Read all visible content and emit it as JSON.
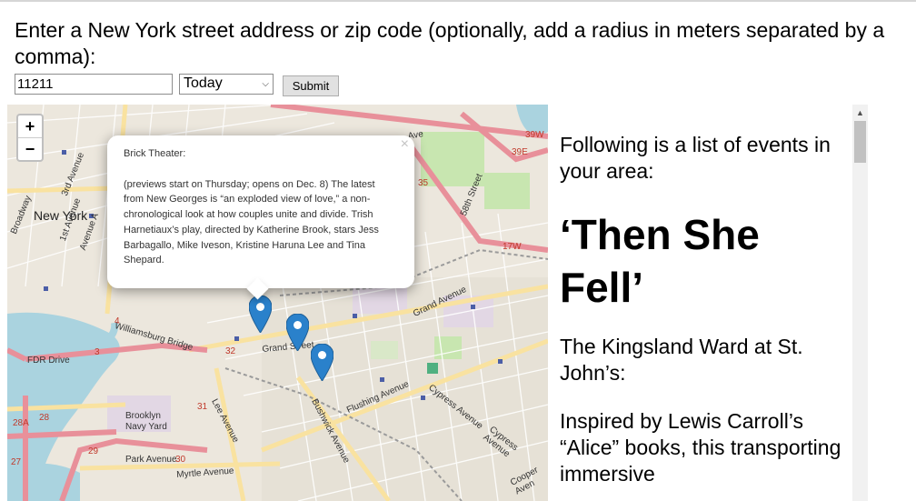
{
  "form": {
    "prompt": "Enter a New York street address or zip code (optionally, add a radius in meters separated by a comma):",
    "address_value": "11211",
    "day_selected": "Today",
    "submit_label": "Submit"
  },
  "map": {
    "zoom_in": "+",
    "zoom_out": "−",
    "labels": {
      "new_york": "New York",
      "broadway": "Broadway",
      "williamsburg_bridge": "Williamsburg Bridge",
      "fdr_drive": "FDR Drive",
      "grand_street": "Grand Street",
      "grand_avenue": "Grand Avenue",
      "flushing_avenue": "Flushing Avenue",
      "cypress_avenue": "Cypress Avenue",
      "cypress_avenue_2": "Cypress Avenue",
      "bushwick_avenue": "Bushwick Avenue",
      "lee_avenue": "Lee Avenue",
      "navy_yard": "Brooklyn Navy Yard",
      "park_avenue": "Park Avenue",
      "myrtle_avenue": "Myrtle Avenue",
      "cooper_avenue": "Cooper Aven",
      "st58": "58th Street",
      "ave_1st": "1st Avenue",
      "ave_a": "Avenue A",
      "ave_3rd": "3rd Avenue",
      "route_39w": "39W",
      "route_39e": "39E",
      "route_17w": "17W",
      "route_35": "35",
      "route_4": "4",
      "route_3": "3",
      "route_32": "32",
      "route_31": "31",
      "route_28": "28",
      "route_28a": "28A",
      "route_29": "29",
      "route_30": "30",
      "route_27": "27",
      "ave": "Ave"
    },
    "popup": {
      "title": "Brick Theater:",
      "body": "(previews start on Thursday; opens on Dec. 8) The latest from New Georges is “an exploded view of love,” a non-chronological look at how couples unite and divide. Trish Harnetiaux’s play, directed by Katherine Brook, stars Jess Barbagallo, Mike Iveson, Kristine Haruna Lee and Tina Shepard.",
      "close": "×"
    }
  },
  "events": {
    "intro": "Following is a list of events in your area:",
    "title": "‘Then She Fell’",
    "venue": "The Kingsland Ward at St. John’s:",
    "description": "Inspired by Lewis Carroll’s “Alice” books, this transporting immersive"
  },
  "colors": {
    "marker": "#2a81cb",
    "highway": "#e8909a",
    "major_road": "#f9e2a0",
    "water": "#aad3df",
    "park": "#c8e6b0"
  }
}
